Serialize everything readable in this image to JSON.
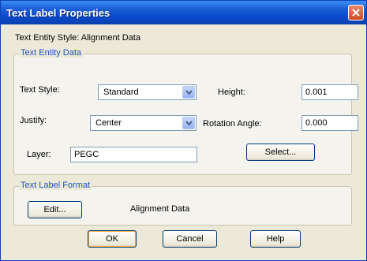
{
  "window": {
    "title": "Text Label Properties"
  },
  "style_line": "Text Entity Style: Alignment Data",
  "entity_group": {
    "legend": "Text Entity Data",
    "text_style_label": "Text Style:",
    "text_style_value": "Standard",
    "height_label": "Height:",
    "height_value": "0.001",
    "justify_label": "Justify:",
    "justify_value": "Center",
    "rotation_label": "Rotation Angle:",
    "rotation_value": "0.000",
    "layer_label": "Layer:",
    "layer_value": "PEGC",
    "select_label": "Select..."
  },
  "format_group": {
    "legend": "Text Label Format",
    "edit_label": "Edit...",
    "format_name": "Alignment Data"
  },
  "buttons": {
    "ok": "OK",
    "cancel": "Cancel",
    "help": "Help"
  },
  "colors": {
    "titlebar": "#0a49c9",
    "legend_text": "#1c52c4",
    "close": "#d24a23"
  }
}
